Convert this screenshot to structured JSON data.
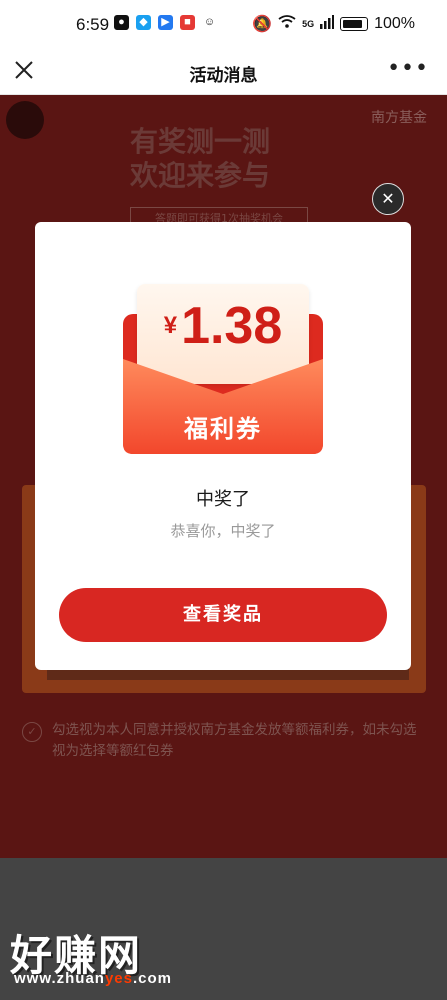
{
  "status_bar": {
    "time": "6:59",
    "network": "5G",
    "battery": "100%"
  },
  "nav": {
    "title": "活动消息"
  },
  "background": {
    "brand": "南方基金",
    "title_line1": "有奖测一测",
    "title_line2": "欢迎来参与",
    "banner": "答题即可获得1次抽奖机会",
    "consent_text": "勾选视为本人同意并授权南方基金发放等额福利券，如未勾选视为选择等额红包券"
  },
  "modal": {
    "currency": "¥",
    "amount": "1.38",
    "coupon_label": "福利券",
    "title": "中奖了",
    "subtitle": "恭喜你，中奖了",
    "button": "查看奖品"
  },
  "watermark": {
    "top": "好赚网",
    "bottom_pre": "www.zhuan",
    "bottom_hl": "yes",
    "bottom_post": ".com"
  },
  "colors": {
    "accent": "#d82722",
    "overlay_bg": "#5a1513"
  }
}
